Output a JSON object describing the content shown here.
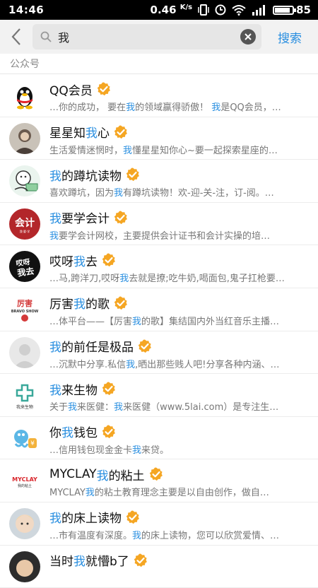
{
  "status": {
    "time": "14:46",
    "speed": "0.46",
    "speed_unit": "K/s",
    "battery": "85",
    "battery_level": 0.85
  },
  "search": {
    "query": "我",
    "action_label": "搜索"
  },
  "section_label": "公众号",
  "accounts": [
    {
      "pre": "QQ会员",
      "hl": "",
      "post": "",
      "desc": [
        [
          "…你的成功， 要在",
          ""
        ],
        [
          "我",
          "hl"
        ],
        [
          "的领域赢得骄傲！ ",
          ""
        ],
        [
          "我",
          "hl"
        ],
        [
          "是QQ会员，…",
          ""
        ]
      ]
    },
    {
      "pre": "星星知",
      "hl": "我",
      "post": "心",
      "desc": [
        [
          "生活爱情迷惘时，",
          ""
        ],
        [
          "我",
          "hl"
        ],
        [
          "懂星星知你心~要一起探索星座的…",
          ""
        ]
      ]
    },
    {
      "pre": "",
      "hl": "我",
      "post": "的蹲坑读物",
      "desc": [
        [
          "喜欢蹲坑，因为",
          ""
        ],
        [
          "我",
          "hl"
        ],
        [
          "有蹲坑读物！欢-迎-关-注，订-阅。…",
          ""
        ]
      ]
    },
    {
      "pre": "",
      "hl": "我",
      "post": "要学会计",
      "desc": [
        [
          "我",
          "hl"
        ],
        [
          "要学会计网校，主要提供会计证书和会计实操的培…",
          ""
        ]
      ]
    },
    {
      "pre": "哎呀",
      "hl": "我",
      "post": "去",
      "desc": [
        [
          "…马,跨洋刀,哎呀",
          ""
        ],
        [
          "我",
          "hl"
        ],
        [
          "去就是撩;吃牛奶,喝面包,鬼子扛枪要…",
          ""
        ]
      ]
    },
    {
      "pre": "厉害",
      "hl": "我",
      "post": "的歌",
      "desc": [
        [
          "…体平台——【厉害",
          ""
        ],
        [
          "我",
          "hl"
        ],
        [
          "的歌】集结国内外当红音乐主播…",
          ""
        ]
      ]
    },
    {
      "pre": "",
      "hl": "我",
      "post": "的前任是极品",
      "desc": [
        [
          "…沉默中分享.私信",
          ""
        ],
        [
          "我",
          "hl"
        ],
        [
          ",晒出那些贱人吧!分享各种内涵、…",
          ""
        ]
      ]
    },
    {
      "pre": "",
      "hl": "我",
      "post": "来生物",
      "desc": [
        [
          "关于",
          ""
        ],
        [
          "我",
          "hl"
        ],
        [
          "来医健：",
          ""
        ],
        [
          "我",
          "hl"
        ],
        [
          "来医健（www.5lai.com）是专注生…",
          ""
        ]
      ]
    },
    {
      "pre": "你",
      "hl": "我",
      "post": "钱包",
      "desc": [
        [
          "…信用钱包现金金卡",
          ""
        ],
        [
          "我",
          "hl"
        ],
        [
          "来贷。",
          ""
        ]
      ]
    },
    {
      "pre": "MYCLAY",
      "hl": "我",
      "post": "的粘土",
      "desc": [
        [
          "MYCLAY",
          ""
        ],
        [
          "我",
          "hl"
        ],
        [
          "的粘土教育理念主要是以自由创作，做自…",
          ""
        ]
      ]
    },
    {
      "pre": "",
      "hl": "我",
      "post": "的床上读物",
      "desc": [
        [
          "…市有温度有深度。",
          ""
        ],
        [
          "我",
          "hl"
        ],
        [
          "的床上读物，您可以欣赏爱情、…",
          ""
        ]
      ]
    },
    {
      "pre": "当时",
      "hl": "我",
      "post": "就懵b了",
      "desc": []
    }
  ],
  "avatar_labels": {
    "kuaiji": "会计",
    "kuaiji_sub": "我·要·学",
    "aiya_top": "哎呀",
    "aiya_bottom": "我去",
    "lihai_top": "厉害",
    "lihai_bottom": "BRAVO SHOW",
    "wolai": "我来生物",
    "myclay": "MYCLAY",
    "myclay_sub": "我的粘土"
  },
  "colors": {
    "accent": "#2a8fe0",
    "badge": "#f5a623",
    "statusbar": "#000000"
  },
  "icons": [
    "back-arrow-icon",
    "search-icon",
    "clear-icon",
    "verified-badge-icon"
  ]
}
